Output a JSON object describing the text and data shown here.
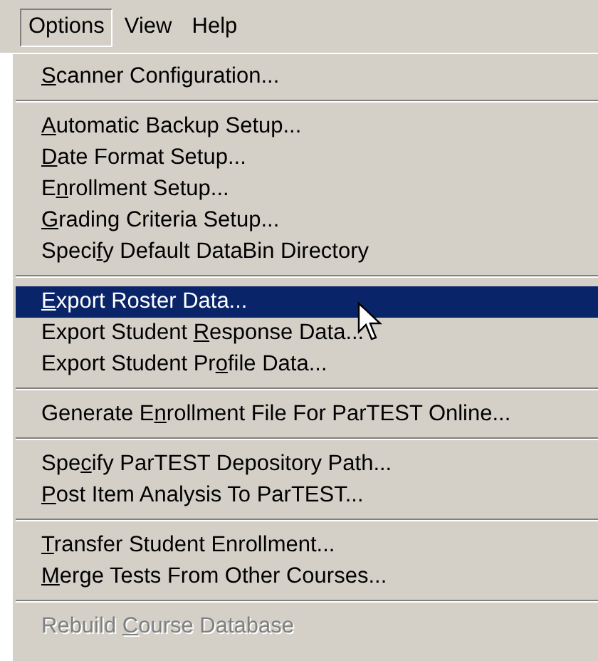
{
  "menubar": [
    {
      "label": "Options",
      "selected": true
    },
    {
      "label": "View",
      "selected": false
    },
    {
      "label": "Help",
      "selected": false
    }
  ],
  "menu": {
    "groups": [
      [
        {
          "accel": "S",
          "after": "canner Configuration...",
          "selected": false,
          "disabled": false
        }
      ],
      [
        {
          "accel": "A",
          "after": "utomatic Backup Setup...",
          "selected": false,
          "disabled": false
        },
        {
          "accel": "D",
          "after": "ate Format Setup...",
          "selected": false,
          "disabled": false
        },
        {
          "before": "E",
          "accel": "n",
          "after": "rollment Setup...",
          "selected": false,
          "disabled": false
        },
        {
          "accel": "G",
          "after": "rading Criteria Setup...",
          "selected": false,
          "disabled": false
        },
        {
          "before": "Speci",
          "accel": "f",
          "after": "y Default DataBin Directory",
          "selected": false,
          "disabled": false
        }
      ],
      [
        {
          "accel": "E",
          "after": "xport Roster Data...",
          "selected": true,
          "disabled": false
        },
        {
          "before": "Export Student ",
          "accel": "R",
          "after": "esponse Data...",
          "selected": false,
          "disabled": false
        },
        {
          "before": "Export Student Pr",
          "accel": "o",
          "after": "file Data...",
          "selected": false,
          "disabled": false
        }
      ],
      [
        {
          "before": "Generate E",
          "accel": "n",
          "after": "rollment File For ParTEST Online...",
          "selected": false,
          "disabled": false
        }
      ],
      [
        {
          "before": "Spe",
          "accel": "c",
          "after": "ify ParTEST Depository Path...",
          "selected": false,
          "disabled": false
        },
        {
          "accel": "P",
          "after": "ost Item Analysis To ParTEST...",
          "selected": false,
          "disabled": false
        }
      ],
      [
        {
          "accel": "T",
          "after": "ransfer Student Enrollment...",
          "selected": false,
          "disabled": false
        },
        {
          "accel": "M",
          "after": "erge Tests From Other Courses...",
          "selected": false,
          "disabled": false
        }
      ],
      [
        {
          "before": "Rebuild ",
          "accel": "C",
          "after": "ourse Database",
          "selected": false,
          "disabled": true
        }
      ]
    ]
  }
}
